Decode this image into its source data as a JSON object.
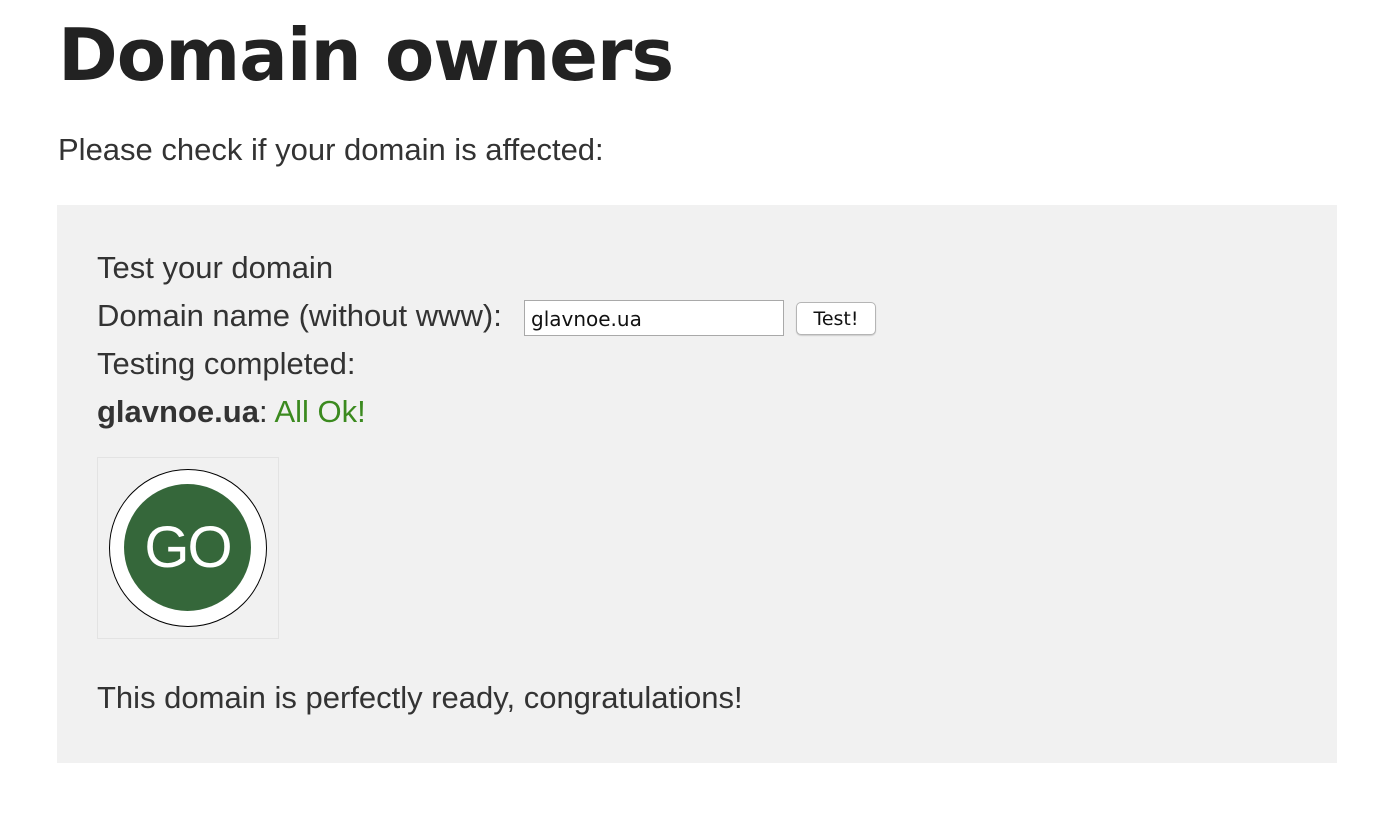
{
  "page": {
    "title": "Domain owners",
    "intro": "Please check if your domain is affected:"
  },
  "panel": {
    "heading": "Test your domain",
    "domain_label": "Domain name (without www):",
    "domain_value": "glavnoe.ua",
    "test_button_label": "Test!",
    "status_label": "Testing completed:",
    "result": {
      "domain": "glavnoe.ua",
      "separator": ":",
      "status": "All Ok!",
      "status_color": "#3b8a1f"
    },
    "badge": {
      "text": "GO",
      "color": "#35673a"
    },
    "message": "This domain is perfectly ready, congratulations!"
  }
}
